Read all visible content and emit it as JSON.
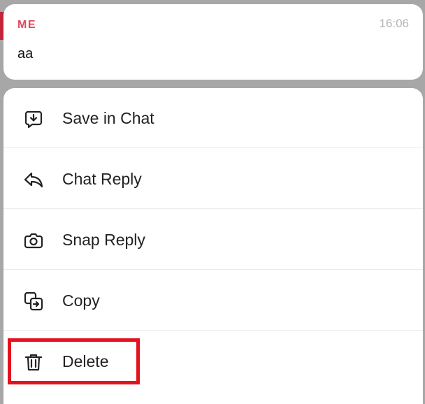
{
  "message": {
    "sender": "ME",
    "time": "16:06",
    "text": "aa"
  },
  "menu": {
    "items": [
      {
        "label": "Save in Chat",
        "icon": "save-in-chat-icon"
      },
      {
        "label": "Chat Reply",
        "icon": "chat-reply-icon"
      },
      {
        "label": "Snap Reply",
        "icon": "camera-icon"
      },
      {
        "label": "Copy",
        "icon": "copy-icon"
      },
      {
        "label": "Delete",
        "icon": "trash-icon"
      }
    ]
  },
  "colors": {
    "background_overlay": "#a7a7a7",
    "sender_accent": "#e04a5f",
    "left_accent": "#c4253b",
    "highlight": "#e2131f"
  }
}
